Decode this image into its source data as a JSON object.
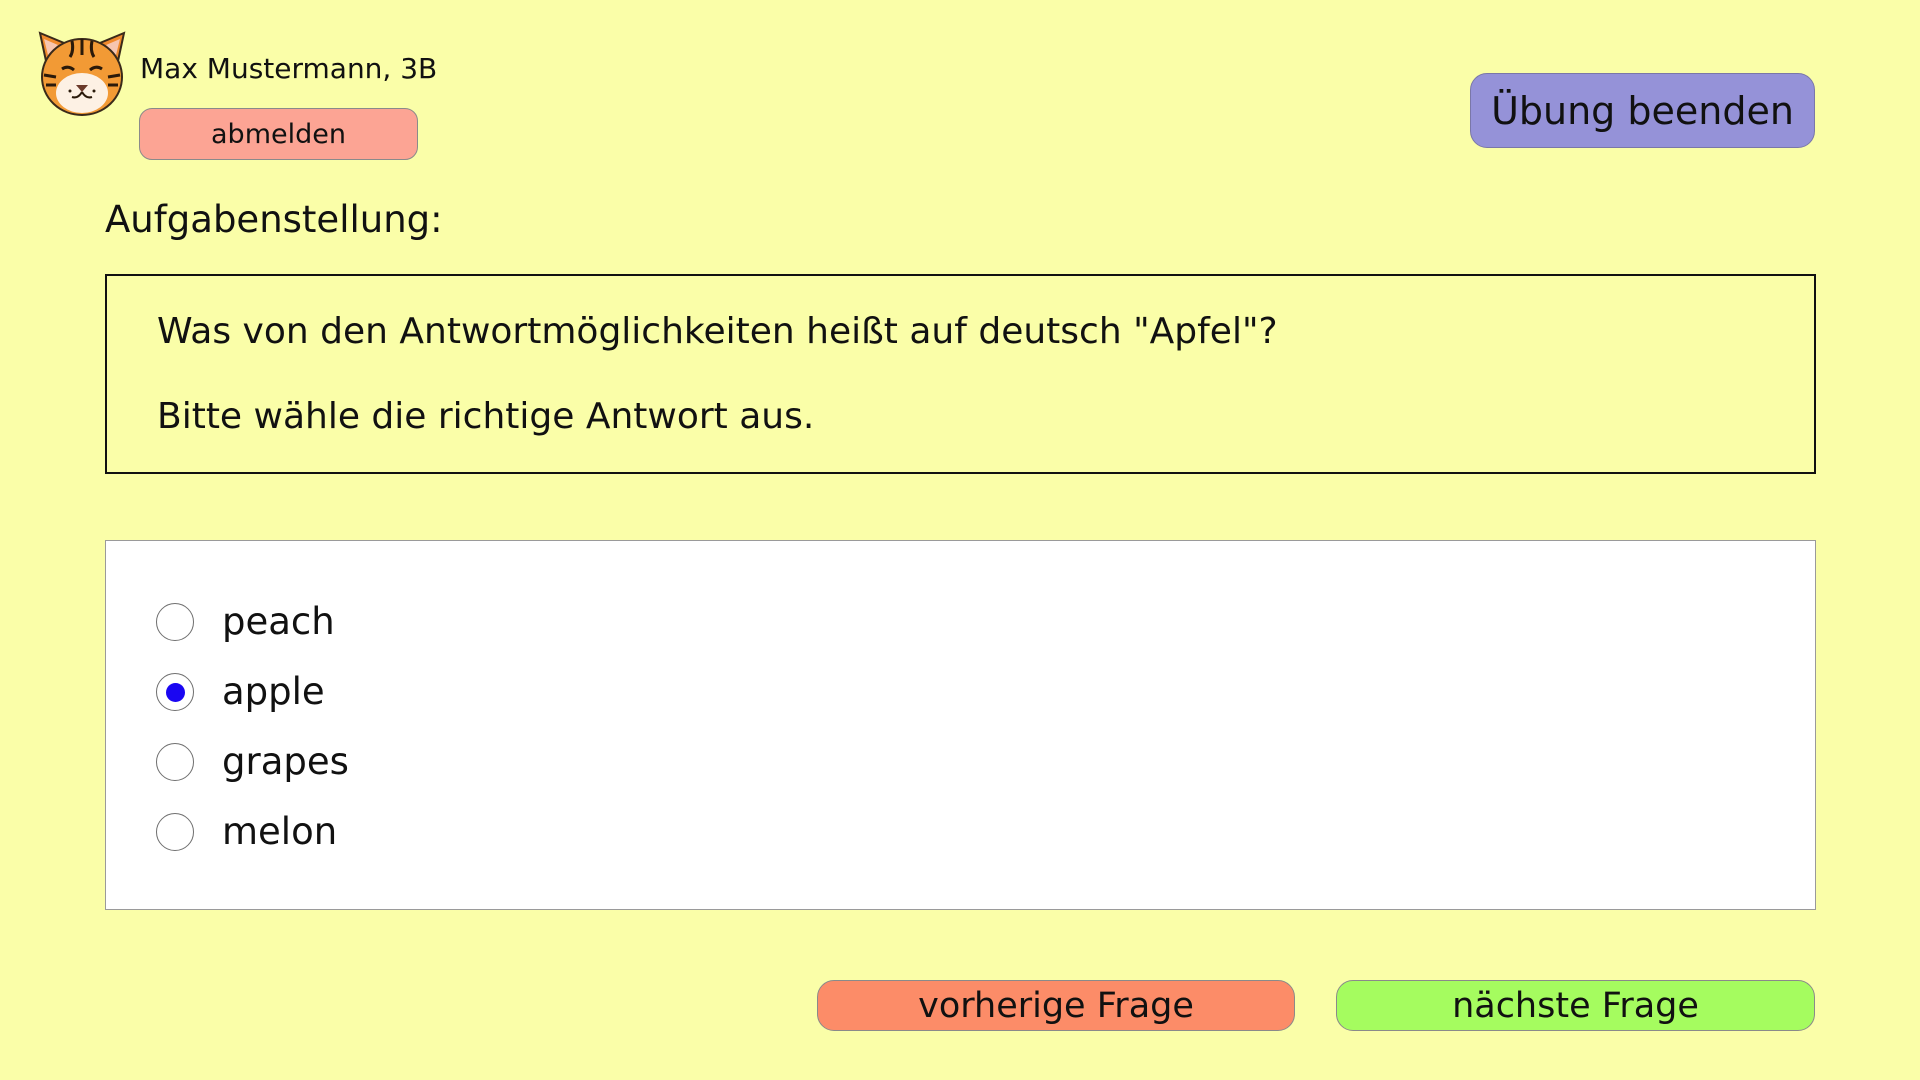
{
  "user": {
    "name": "Max Mustermann, 3B",
    "logout_label": "abmelden",
    "avatar_icon": "tiger-avatar-icon"
  },
  "header": {
    "finish_label": "Übung beenden"
  },
  "task": {
    "heading": "Aufgabenstellung:",
    "question": "Was von den Antwortmöglichkeiten heißt auf deutsch \"Apfel\"?",
    "instruction": "Bitte wähle die richtige Antwort aus."
  },
  "options": [
    {
      "label": "peach",
      "selected": false
    },
    {
      "label": "apple",
      "selected": true
    },
    {
      "label": "grapes",
      "selected": false
    },
    {
      "label": "melon",
      "selected": false
    }
  ],
  "navigation": {
    "prev_label": "vorherige Frage",
    "next_label": "nächste Frage"
  },
  "colors": {
    "background": "#fafea8",
    "logout_button": "#fca494",
    "finish_button": "#9592d8",
    "prev_button": "#fc8c68",
    "next_button": "#a5fc5f",
    "radio_selected": "#1a06f2"
  }
}
